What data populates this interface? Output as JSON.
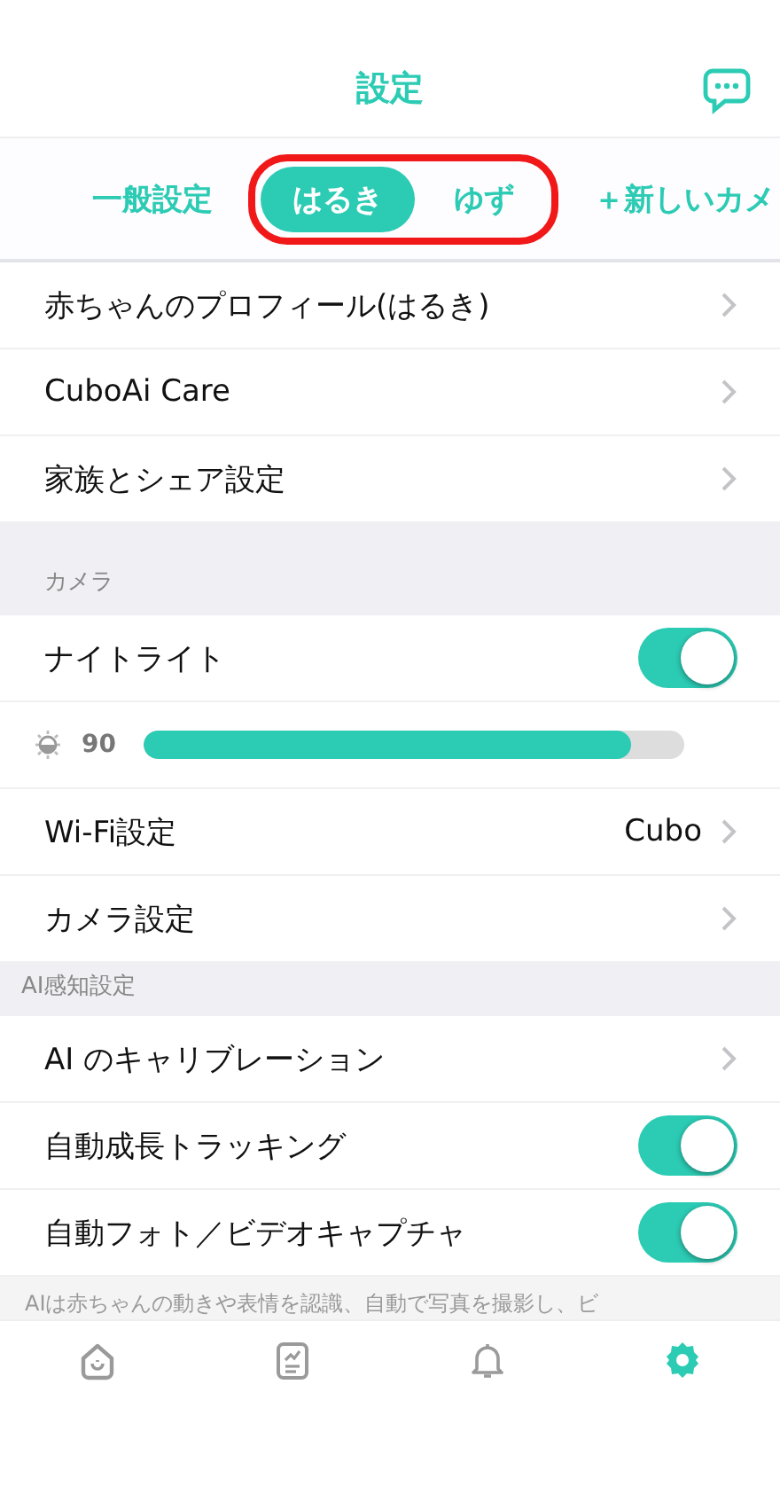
{
  "header": {
    "title": "設定"
  },
  "tabs": [
    {
      "label": "一般設定",
      "selected": false
    },
    {
      "label": "はるき",
      "selected": true,
      "highlighted": true
    },
    {
      "label": "ゆず",
      "selected": false,
      "highlighted": true
    },
    {
      "label": "＋新しいカメ",
      "selected": false
    }
  ],
  "sections": [
    {
      "items": [
        {
          "kind": "link",
          "label": "赤ちゃんのプロフィール(はるき)"
        },
        {
          "kind": "link",
          "label": "CuboAi Care"
        },
        {
          "kind": "link",
          "label": "家族とシェア設定"
        }
      ]
    },
    {
      "header": "カメラ",
      "items": [
        {
          "kind": "toggle",
          "label": "ナイトライト",
          "on": true
        },
        {
          "kind": "slider",
          "reading": "90",
          "level": 0.9
        },
        {
          "kind": "link",
          "label": "Wi-Fi設定",
          "value": "Cubo"
        },
        {
          "kind": "link",
          "label": "カメラ設定"
        }
      ]
    },
    {
      "header": "AI感知設定",
      "items": [
        {
          "kind": "link",
          "label": "AI のキャリブレーション"
        },
        {
          "kind": "toggle",
          "label": "自動成長トラッキング",
          "on": true
        },
        {
          "kind": "toggle",
          "label": "自動フォト／ビデオキャプチャ",
          "on": true
        }
      ]
    }
  ],
  "footnote": "AIは赤ちゃんの動きや表情を認識、自動で写真を撮影し、ビ",
  "nav": [
    {
      "kind": "home",
      "selected": false
    },
    {
      "kind": "journal",
      "selected": false
    },
    {
      "kind": "alerts",
      "selected": false
    },
    {
      "kind": "settings",
      "selected": true
    }
  ]
}
